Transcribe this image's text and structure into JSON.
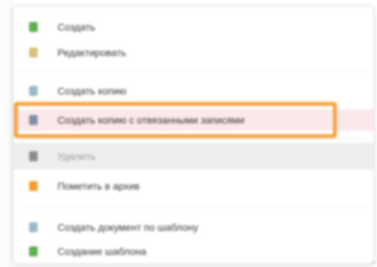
{
  "menu": {
    "items": [
      {
        "label": "Создать",
        "icon": "plus-green-icon",
        "color": "#5bb04f"
      },
      {
        "label": "Редактировать",
        "icon": "pencil-icon",
        "color": "#d7c07a"
      },
      {
        "label": "Создать копию",
        "icon": "copy-icon",
        "color": "#9cb7c9"
      },
      {
        "label": "Создать копию с отвязанными записями",
        "icon": "copy-unlinked-icon",
        "color": "#7f8fa6"
      },
      {
        "label": "Удалить",
        "icon": "delete-icon",
        "color": "#8c8c8c"
      },
      {
        "label": "Пометить в архив",
        "icon": "archive-star-icon",
        "color": "#f0a030"
      },
      {
        "label": "Создать документ по шаблону",
        "icon": "template-document-icon",
        "color": "#9cb7c9"
      },
      {
        "label": "Создание шаблона",
        "icon": "template-create-icon",
        "color": "#5bb04f"
      }
    ]
  },
  "highlight": {
    "color": "#f5a03a"
  }
}
